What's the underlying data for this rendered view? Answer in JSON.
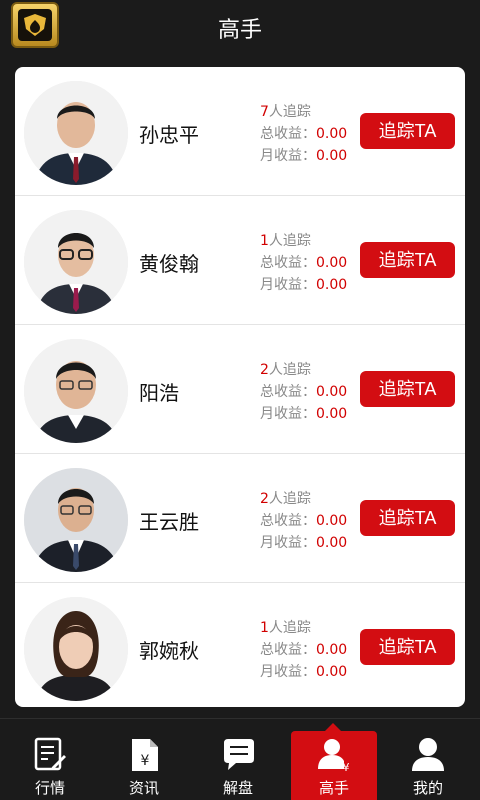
{
  "header": {
    "title": "高手",
    "logo_icon": "shield-logo-icon"
  },
  "traders": [
    {
      "name": "孙忠平",
      "followers": "7",
      "followers_suffix": "人追踪",
      "total_label": "总收益：",
      "total_value": "0.00",
      "monthly_label": "月收益：",
      "monthly_value": "0.00",
      "button": "追踪TA"
    },
    {
      "name": "黄俊翰",
      "followers": "1",
      "followers_suffix": "人追踪",
      "total_label": "总收益：",
      "total_value": "0.00",
      "monthly_label": "月收益：",
      "monthly_value": "0.00",
      "button": "追踪TA"
    },
    {
      "name": "阳浩",
      "followers": "2",
      "followers_suffix": "人追踪",
      "total_label": "总收益：",
      "total_value": "0.00",
      "monthly_label": "月收益：",
      "monthly_value": "0.00",
      "button": "追踪TA"
    },
    {
      "name": "王云胜",
      "followers": "2",
      "followers_suffix": "人追踪",
      "total_label": "总收益：",
      "total_value": "0.00",
      "monthly_label": "月收益：",
      "monthly_value": "0.00",
      "button": "追踪TA"
    },
    {
      "name": "郭婉秋",
      "followers": "1",
      "followers_suffix": "人追踪",
      "total_label": "总收益：",
      "total_value": "0.00",
      "monthly_label": "月收益：",
      "monthly_value": "0.00",
      "button": "追踪TA"
    }
  ],
  "tabs": [
    {
      "label": "行情",
      "icon": "quotes-icon"
    },
    {
      "label": "资讯",
      "icon": "news-icon"
    },
    {
      "label": "解盘",
      "icon": "chat-icon"
    },
    {
      "label": "高手",
      "icon": "expert-icon",
      "active": true
    },
    {
      "label": "我的",
      "icon": "profile-icon"
    }
  ],
  "colors": {
    "accent": "#d30d12",
    "value_red": "#d10000",
    "bar_bg": "#1b1b1b"
  }
}
